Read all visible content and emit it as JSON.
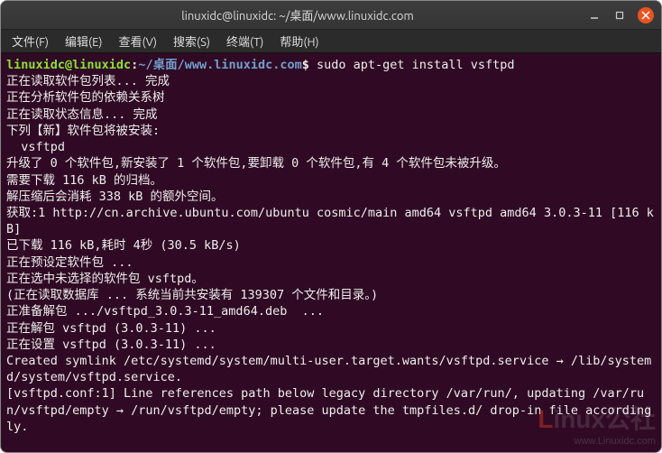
{
  "window": {
    "title": "linuxidc@linuxidc: ~/桌面/www.linuxidc.com"
  },
  "menubar": {
    "file": "文件(F)",
    "edit": "编辑(E)",
    "view": "查看(V)",
    "search": "搜索(S)",
    "terminal": "终端(T)",
    "help": "帮助(H)"
  },
  "prompt": {
    "user_host": "linuxidc@linuxidc",
    "sep1": ":",
    "path_tilde": "~/桌面",
    "path_rest": "/www.linuxidc.com",
    "sep2": "$",
    "command": " sudo apt-get install vsftpd"
  },
  "output": {
    "l1": "正在读取软件包列表... 完成",
    "l2": "正在分析软件包的依赖关系树",
    "l3": "正在读取状态信息... 完成",
    "l4": "下列【新】软件包将被安装:",
    "l5": "  vsftpd",
    "l6": "升级了 0 个软件包,新安装了 1 个软件包,要卸载 0 个软件包,有 4 个软件包未被升级。",
    "l7": "需要下载 116 kB 的归档。",
    "l8": "解压缩后会消耗 338 kB 的额外空间。",
    "l9": "获取:1 http://cn.archive.ubuntu.com/ubuntu cosmic/main amd64 vsftpd amd64 3.0.3-11 [116 kB]",
    "l10": "已下载 116 kB,耗时 4秒 (30.5 kB/s)",
    "l11": "正在预设定软件包 ...",
    "l12": "正在选中未选择的软件包 vsftpd。",
    "l13": "(正在读取数据库 ... 系统当前共安装有 139307 个文件和目录。)",
    "l14": "正准备解包 .../vsftpd_3.0.3-11_amd64.deb  ...",
    "l15": "正在解包 vsftpd (3.0.3-11) ...",
    "l16": "正在设置 vsftpd (3.0.3-11) ...",
    "l17": "Created symlink /etc/systemd/system/multi-user.target.wants/vsftpd.service → /lib/systemd/system/vsftpd.service.",
    "l18": "[vsftpd.conf:1] Line references path below legacy directory /var/run/, updating /var/run/vsftpd/empty → /run/vsftpd/empty; please update the tmpfiles.d/ drop-in file accordingly."
  },
  "watermark": {
    "brand_a": "L",
    "brand_b": "inux",
    "brand_cn": "公社",
    "url": "www.Linuxidc.com"
  }
}
